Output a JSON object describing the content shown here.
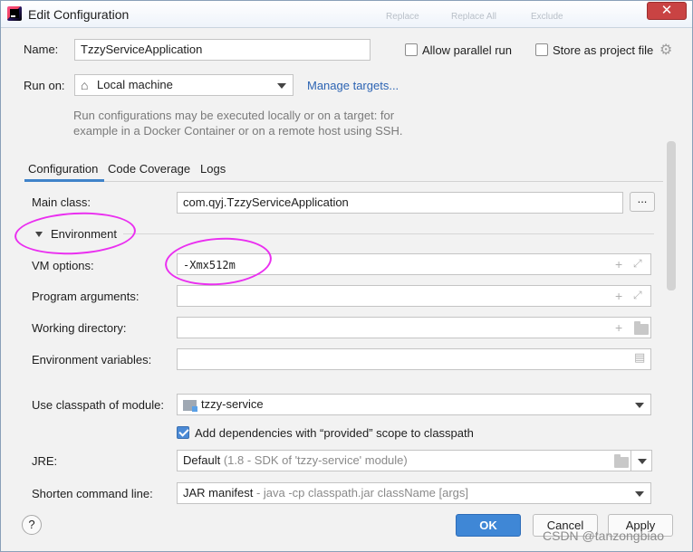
{
  "window": {
    "title": "Edit Configuration",
    "close_glyph": "✕",
    "ghost_tabs": [
      "Replace",
      "Replace All",
      "Exclude"
    ]
  },
  "name": {
    "label": "Name:",
    "value": "TzzyServiceApplication"
  },
  "allow_parallel_run": {
    "label": "Allow parallel run",
    "checked": false
  },
  "store_as_project_file": {
    "label": "Store as project file",
    "checked": false,
    "icon": "gear-icon"
  },
  "run_on": {
    "label": "Run on:",
    "value": "Local machine",
    "icon": "home-icon",
    "manage_link": "Manage targets..."
  },
  "hint": {
    "line1": "Run configurations may be executed locally or on a target: for",
    "line2": "example in a Docker Container or on a remote host using SSH."
  },
  "tabs": [
    "Configuration",
    "Code Coverage",
    "Logs"
  ],
  "active_tab": 0,
  "main_class": {
    "label": "Main class:",
    "value": "com.qyj.TzzyServiceApplication",
    "browse": "..."
  },
  "environment": {
    "label": "Environment",
    "expanded": true
  },
  "vm_options": {
    "label": "VM options:",
    "value": "-Xmx512m"
  },
  "program_arguments": {
    "label": "Program arguments:",
    "value": ""
  },
  "working_directory": {
    "label": "Working directory:",
    "value": ""
  },
  "environment_variables": {
    "label": "Environment variables:",
    "value": ""
  },
  "classpath_module": {
    "label": "Use classpath of module:",
    "value": "tzzy-service"
  },
  "provided_scope": {
    "label": "Add dependencies with  “provided”  scope to classpath",
    "checked": true
  },
  "jre": {
    "label": "JRE:",
    "value": "Default",
    "detail": "(1.8 - SDK of 'tzzy-service' module)"
  },
  "shorten_command_line": {
    "label": "Shorten command line:",
    "value": "JAR manifest",
    "detail": "- java -cp classpath.jar className [args]"
  },
  "footer": {
    "help": "?",
    "ok": "OK",
    "cancel": "Cancel",
    "apply": "Apply"
  },
  "watermark": "CSDN @tanzongbiao",
  "colors": {
    "accent": "#3f87d6",
    "annotation": "#ea2ff0",
    "link": "#2d64b3",
    "close": "#c94343"
  }
}
